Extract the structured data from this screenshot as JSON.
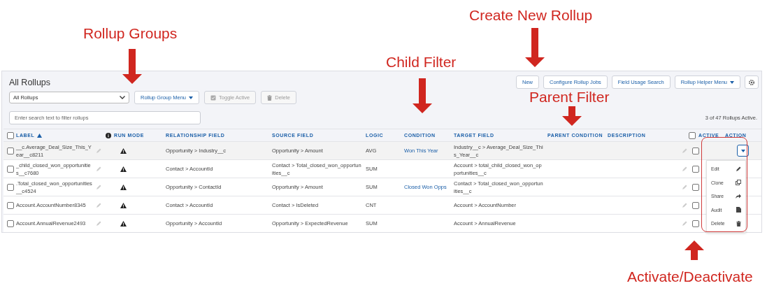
{
  "annotations": [
    {
      "text": "Rollup Groups",
      "kind": "down"
    },
    {
      "text": "Create New Rollup",
      "kind": "down"
    },
    {
      "text": "Child Filter",
      "kind": "down"
    },
    {
      "text": "Parent Filter",
      "kind": "down"
    },
    {
      "text": "Activate/Deactivate",
      "kind": "up"
    }
  ],
  "app": {
    "title": "All Rollups",
    "toolbar": [
      {
        "label": "New",
        "kind": "plain"
      },
      {
        "label": "Configure Rollup Jobs",
        "kind": "plain"
      },
      {
        "label": "Field Usage Search",
        "kind": "plain"
      },
      {
        "label": "Rollup Helper Menu",
        "kind": "menu"
      },
      {
        "kind": "settings"
      }
    ],
    "group_select": {
      "value": "All Rollups"
    },
    "group_buttons": [
      {
        "label": "Rollup Group Menu",
        "kind": "menu",
        "disabled": false
      },
      {
        "label": "Toggle Active",
        "kind": "toggle",
        "disabled": true
      },
      {
        "label": "Delete",
        "kind": "delete",
        "disabled": true
      }
    ],
    "search": {
      "placeholder": "Enter search text to filter rollups"
    },
    "status": "3 of 47 Rollups Active.",
    "table": {
      "select_all": {
        "checked": false
      },
      "columns": [
        {
          "label": "LABEL",
          "kind": "ascending"
        },
        {
          "label": "RUN MODE",
          "kind": "info"
        },
        {
          "label": "RELATIONSHIP FIELD"
        },
        {
          "label": "SOURCE FIELD"
        },
        {
          "label": "LOGIC"
        },
        {
          "label": "CONDITION"
        },
        {
          "label": "TARGET FIELD"
        },
        {
          "label": "PARENT CONDITION"
        },
        {
          "label": "DESCRIPTION"
        },
        {
          "label": "ACTIVE",
          "kind": "checkbox",
          "checked": false
        },
        {
          "label": "ACTION"
        }
      ],
      "rows": [
        {
          "checked": false,
          "highlighted": true,
          "label": "__c.Average_Deal_Size_This_Year__c8211",
          "relationship": "Opportunity > Industry__c",
          "source": "Opportunity > Amount",
          "logic": "AVG",
          "condition": "Won This Year",
          "target": "Industry__c > Average_Deal_Size_This_Year__c",
          "active": false,
          "menu_open": true
        },
        {
          "checked": false,
          "highlighted": false,
          "label": "_child_closed_won_opportunities__c7680",
          "relationship": "Contact > AccountId",
          "source": "Contact > Total_closed_won_opportunities__c",
          "logic": "SUM",
          "target": "Account > total_child_closed_won_opportunities__c",
          "active": false,
          "menu_open": false
        },
        {
          "checked": false,
          "highlighted": false,
          "label": ".Total_closed_won_opportunities__c4524",
          "relationship": "Opportunity > ContactId",
          "source": "Opportunity > Amount",
          "logic": "SUM",
          "condition": "Closed Won Opps",
          "target": "Contact > Total_closed_won_opportunities__c",
          "active": false,
          "menu_open": false
        },
        {
          "checked": false,
          "highlighted": false,
          "label": "Account.AccountNumber8345",
          "relationship": "Contact > AccountId",
          "source": "Contact > IsDeleted",
          "logic": "CNT",
          "target": "Account > AccountNumber",
          "active": false,
          "menu_open": false
        },
        {
          "checked": false,
          "highlighted": false,
          "label": "Account.AnnualRevenue2493",
          "relationship": "Opportunity > AccountId",
          "source": "Opportunity > ExpectedRevenue",
          "logic": "SUM",
          "target": "Account > AnnualRevenue",
          "active": false,
          "menu_open": false
        }
      ],
      "action_menu": [
        {
          "label": "Edit",
          "kind": "edit"
        },
        {
          "label": "Clone",
          "kind": "clone"
        },
        {
          "label": "Share",
          "kind": "share"
        },
        {
          "label": "Audit",
          "kind": "audit"
        },
        {
          "label": "Delete",
          "kind": "delete"
        }
      ]
    }
  }
}
